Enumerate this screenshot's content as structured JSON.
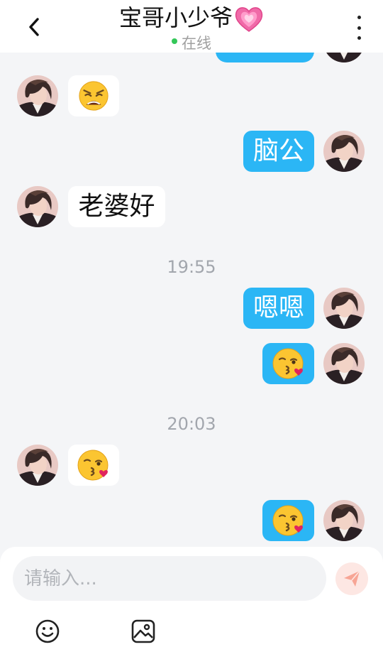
{
  "header": {
    "title": "宝哥小少爷",
    "title_emoji": "growing-heart",
    "status": "在线",
    "status_color": "#34c759",
    "back_icon": "chevron-left-icon",
    "more_icon": "more-vertical-icon"
  },
  "messages": [
    {
      "direction": "out",
      "type": "text",
      "text": "",
      "partial": true
    },
    {
      "direction": "in",
      "type": "emoji",
      "emoji": "weary-face"
    },
    {
      "direction": "out",
      "type": "text",
      "text": "脑公"
    },
    {
      "direction": "in",
      "type": "text",
      "text": "老婆好"
    },
    {
      "type": "timestamp",
      "text": "19:55"
    },
    {
      "direction": "out",
      "type": "text",
      "text": "嗯嗯"
    },
    {
      "direction": "out",
      "type": "emoji",
      "emoji": "face-blowing-a-kiss"
    },
    {
      "type": "timestamp",
      "text": "20:03"
    },
    {
      "direction": "in",
      "type": "emoji",
      "emoji": "face-blowing-a-kiss"
    },
    {
      "direction": "out",
      "type": "emoji",
      "emoji": "face-blowing-a-kiss"
    }
  ],
  "composer": {
    "placeholder": "请输入...",
    "send_icon": "paper-plane-icon",
    "emoji_icon": "smiley-icon",
    "image_icon": "image-icon"
  },
  "colors": {
    "outgoing_bubble": "#2bb6f5",
    "incoming_bubble": "#ffffff",
    "background": "#f4f5f7"
  }
}
